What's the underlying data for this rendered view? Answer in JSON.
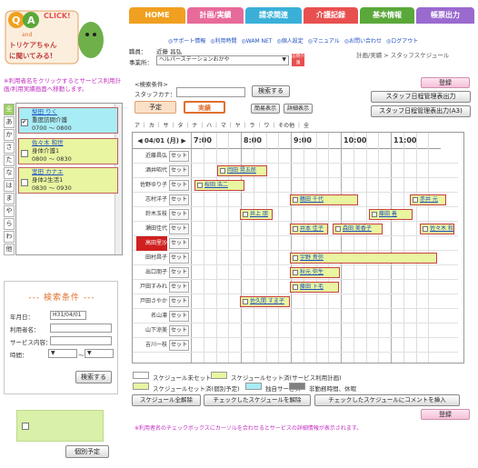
{
  "logo": {
    "text1": "Q",
    "text2": "A",
    "click": "CLICK!",
    "and": "and",
    "line1": "トリケアちゃん",
    "line2": "に聞いてみる!"
  },
  "notice": "※利用者名をクリックするとサービス利用計画/利用実績画面へ移動します。",
  "kana_tabs": [
    "全",
    "あ",
    "か",
    "さ",
    "た",
    "な",
    "は",
    "ま",
    "や",
    "ら",
    "わ",
    "他"
  ],
  "staff_entries": [
    {
      "name": "梨田 りく",
      "service": "重度訪問介護",
      "time": "0700 ～ 0800",
      "checked": true,
      "bg": "#a8ecf5"
    },
    {
      "name": "佐々木 和世",
      "service": "身体介護1",
      "time": "0800 ～ 0830",
      "checked": false,
      "bg": "#e9f5a0"
    },
    {
      "name": "室田 カナエ",
      "service": "身体2生活1",
      "time": "0830 ～ 0930",
      "checked": false,
      "bg": "#e9f5a0"
    }
  ],
  "search": {
    "title": "--- 検索条件 ---",
    "date_label": "年月日：",
    "date_value": "H31/04/01",
    "user_label": "利用者名：",
    "service_label": "サービス内容：",
    "time_label": "時間：",
    "button": "検索する"
  },
  "memo_button": "個別予定",
  "nav": [
    {
      "label": "HOME",
      "color": "#f0a020"
    },
    {
      "label": "計画/実績",
      "color": "#e86a9a"
    },
    {
      "label": "請求関連",
      "color": "#3ab0d8"
    },
    {
      "label": "介護記録",
      "color": "#e85050"
    },
    {
      "label": "基本情報",
      "color": "#5aa83a"
    },
    {
      "label": "帳票出力",
      "color": "#9a6acf"
    }
  ],
  "links": [
    "◎サポート情報",
    "◎利用時間",
    "◎WAM NET",
    "◎個人設定",
    "◎マニュアル",
    "◎お問い合わせ",
    "◎ログアウト"
  ],
  "staff_label": "職員：",
  "staff_name": "近藤 昌弘",
  "office_label": "事業所：",
  "office_value": "ヘルパーステーションおかや",
  "office_badge": "訪問介護",
  "breadcrumb": "計画/実績 > スタッフスケジュール",
  "register_button": "登録",
  "search_cond": "<検索条件>",
  "staff_kana_label": "スタッフカナ：",
  "search_button": "検索する",
  "print_btn1": "スタッフ日程管理表出力",
  "print_btn2": "スタッフ日程管理表出力(A3)",
  "mode_plan": "予定",
  "mode_actual": "実績",
  "simple_view": "簡易表示",
  "detail_view": "詳細表示",
  "kana_filter": "ア ｜ カ ｜ サ ｜ タ ｜ ナ ｜ ハ ｜ マ ｜ ヤ ｜ ラ ｜ ワ ｜ その他 ｜ 全",
  "grid_date": "◀ 04/01 (月) ▶",
  "hours": [
    "7:00",
    "8:00",
    "9:00",
    "10:00",
    "11:00"
  ],
  "set_label": "セット",
  "staff_rows": [
    "近藤昌弘",
    "酒井昭代",
    "佐野ゆり子",
    "志村洋子",
    "鈴木玉枝",
    "瀬田佳代",
    "高田里沙",
    "田村昌子",
    "出口朋子",
    "戸田すみれ",
    "戸田さやか",
    "名山凛",
    "山下涼美",
    "吉川一枝"
  ],
  "blocks": [
    {
      "row": 1,
      "label": "岡田 晃五郎"
    },
    {
      "row": 2,
      "label": "桜田 浩二"
    },
    {
      "row": 3,
      "label": "鶴田 千代"
    },
    {
      "row": 3,
      "label": "赤井 元"
    },
    {
      "row": 4,
      "label": "井上 朋"
    },
    {
      "row": 4,
      "label": "藤田 善"
    },
    {
      "row": 5,
      "label": "井本 佳子"
    },
    {
      "row": 5,
      "label": "森田 美香子"
    },
    {
      "row": 5,
      "label": "佐々木 和世"
    },
    {
      "row": 7,
      "label": "宇野 貴弥"
    },
    {
      "row": 8,
      "label": "秋元 弥生"
    },
    {
      "row": 9,
      "label": "藤田 卜毛"
    },
    {
      "row": 10,
      "label": "佐久間 すま子"
    }
  ],
  "legend": [
    {
      "label": "スケジュール未セット",
      "color": "#ffffff"
    },
    {
      "label": "スケジュールセット済(サービス利用計画)",
      "color": "#e9f5a0"
    },
    {
      "label": "スケジュールセット済(個別予定)",
      "color": "#e9f5a0"
    },
    {
      "label": "独自サービス",
      "color": "#a8ecf5"
    },
    {
      "label": "非勤務時間、休暇",
      "color": "#808080"
    }
  ],
  "bottom_buttons": [
    "スケジュール全解除",
    "チェックしたスケジュールを解除",
    "チェックしたスケジュールにコメントを挿入"
  ],
  "register_button2": "登録",
  "footer_note": "※利用者名のチェックボックスにカーソルを合わせるとサービスの詳細情報が表示されます。"
}
